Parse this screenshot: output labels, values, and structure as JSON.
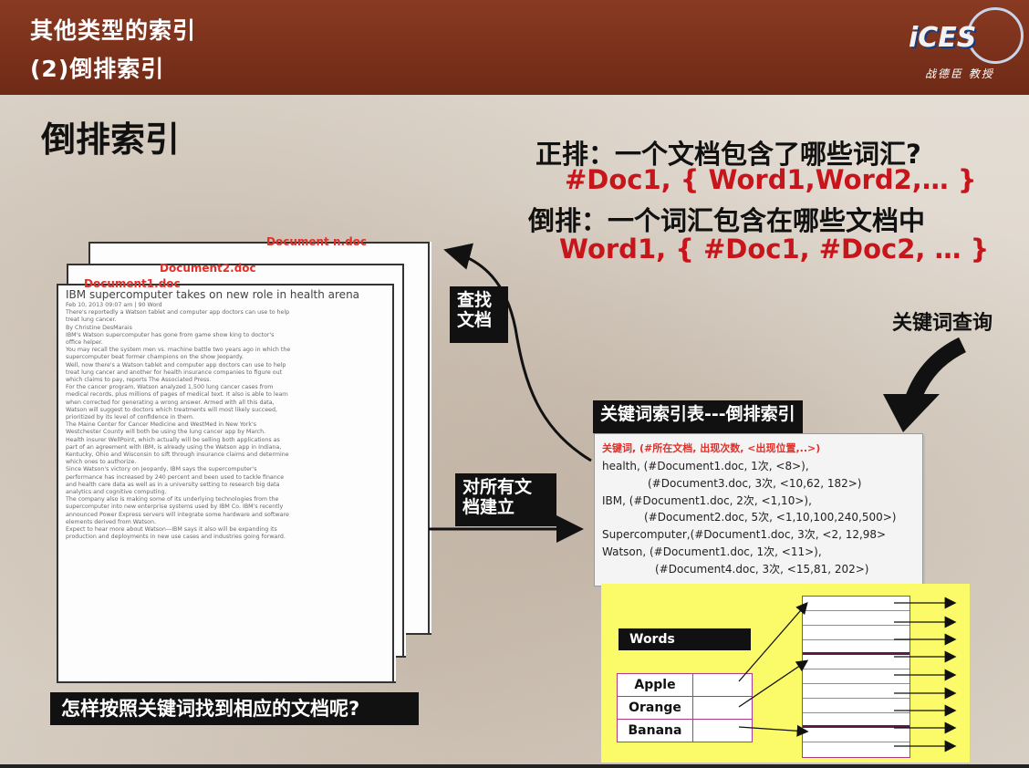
{
  "header": {
    "title_line1": "其他类型的索引",
    "title_line2": "(2)倒排索引",
    "logo_text": "iCES",
    "logo_name": "战德臣 教授"
  },
  "main": {
    "title": "倒排索引",
    "forward_def": "正排：一个文档包含了哪些词汇?",
    "forward_example": "#Doc1, { Word1,Word2,… }",
    "inverted_def": "倒排：一个词汇包含在哪些文档中",
    "inverted_example": "Word1, { #Doc1, #Doc2, … }"
  },
  "documents": {
    "label_n": "Document n.doc",
    "label_2": "Document2.doc",
    "label_1": "Document1.doc",
    "headline": "IBM supercomputer takes on new role in health arena",
    "lines": [
      "Feb 10, 2013 09:07 am | 90 Word",
      "There's reportedly a Watson tablet and computer app doctors can use to help",
      "treat lung cancer.",
      "By Christine DesMarais",
      "IBM's Watson supercomputer has gone from game show king to doctor's",
      "office helper.",
      "You may recall the system men vs. machine battle two years ago in which the",
      "supercomputer beat former champions on the show Jeopardy.",
      "Well, now there's a Watson tablet and computer app doctors can use to help",
      "treat lung cancer and another for health insurance companies to figure out",
      "which claims to pay, reports The Associated Press.",
      "For the cancer program, Watson analyzed 1,500 lung cancer cases from",
      "medical records, plus millions of pages of medical text. It also is able to learn",
      "when corrected for generating a wrong answer. Armed with all this data,",
      "Watson will suggest to doctors which treatments will most likely succeed,",
      "prioritized by its level of confidence in them.",
      "The Maine Center for Cancer Medicine and WestMed in New York's",
      "Westchester County will both be using the lung cancer app by March.",
      "Health insurer WellPoint, which actually will be selling both applications as",
      "part of an agreement with IBM, is already using the Watson app in Indiana,",
      "Kentucky, Ohio and Wisconsin to sift through insurance claims and determine",
      "which ones to authorize.",
      "Since Watson's victory on Jeopardy, IBM says the supercomputer's",
      "performance has increased by 240 percent and been used to tackle finance",
      "and health care data as well as in a university setting to research big data",
      "analytics and cognitive computing.",
      "The company also is making some of its underlying technologies from the",
      "supercomputer into new enterprise systems used by IBM Co. IBM's recently",
      "announced Power Express servers will integrate some hardware and software",
      "elements derived from Watson.",
      "Expect to hear more about Watson—IBM says it also will be expanding its",
      "production and deployments in new use cases and industries going forward."
    ]
  },
  "labels": {
    "find_docs": [
      "查找",
      "文档"
    ],
    "build_all": [
      "对所有文",
      "档建立"
    ],
    "keyword_query": "关键词查询",
    "index_table_title": "关键词索引表---倒排索引",
    "bottom_question": "怎样按照关键词找到相应的文档呢?"
  },
  "index_table": {
    "header": "关键词, (#所在文档, 出现次数, <出现位置,..>)",
    "lines": [
      "health, (#Document1.doc, 1次, <8>),",
      "(#Document3.doc, 3次, <10,62, 182>)",
      "IBM,    (#Document1.doc, 2次, <1,10>),",
      "(#Document2.doc, 5次, <1,10,100,240,500>)",
      "Supercomputer,(#Document1.doc, 3次, <2, 12,98>",
      "Watson, (#Document1.doc, 1次, <11>),",
      "(#Document4.doc, 3次, <15,81, 202>)"
    ]
  },
  "words_table": {
    "header": "Words",
    "rows": [
      "Apple",
      "Orange",
      "Banana"
    ]
  },
  "colors": {
    "header_bg": "#7a311b",
    "accent_red": "#c8141b",
    "doc_label": "#e0302a",
    "yellow_panel": "#fbfb6a",
    "grid_purple": "#b03a8a"
  }
}
